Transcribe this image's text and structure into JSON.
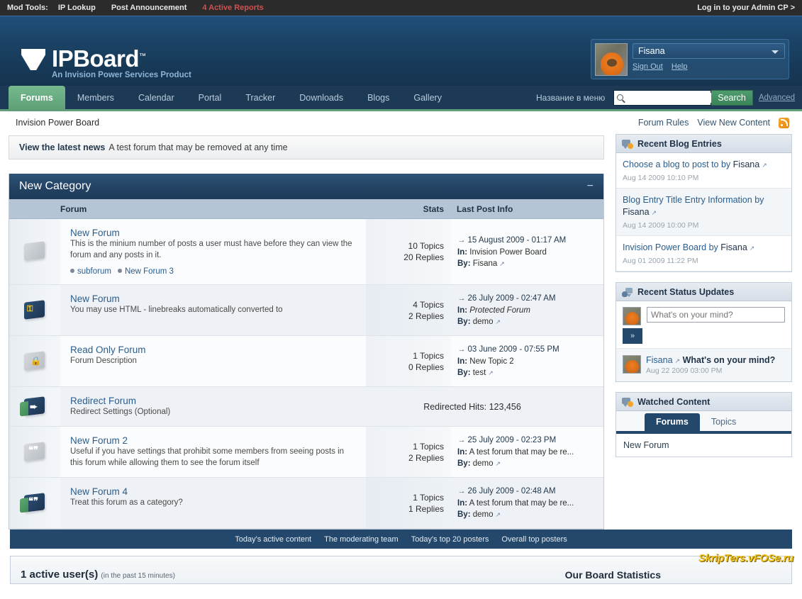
{
  "modbar": {
    "label": "Mod Tools:",
    "links": [
      "IP Lookup",
      "Post Announcement"
    ],
    "reports": "4 Active Reports",
    "admin_cp": "Log in to your Admin CP >"
  },
  "header": {
    "logo_text": "IPBoard",
    "logo_tm": "™",
    "tagline": "An Invision Power Services Product",
    "user": {
      "name": "Fisana",
      "sign_out": "Sign Out",
      "help": "Help"
    }
  },
  "nav": {
    "tabs": [
      {
        "label": "Forums",
        "active": true
      },
      {
        "label": "Members",
        "active": false
      },
      {
        "label": "Calendar",
        "active": false
      },
      {
        "label": "Portal",
        "active": false
      },
      {
        "label": "Tracker",
        "active": false
      },
      {
        "label": "Downloads",
        "active": false
      },
      {
        "label": "Blogs",
        "active": false
      },
      {
        "label": "Gallery",
        "active": false
      }
    ],
    "menu_title": "Название в меню",
    "search_value": "",
    "search_placeholder": "",
    "search_button": "Search",
    "advanced": "Advanced"
  },
  "breadcrumb": "Invision Power Board",
  "toplinks": {
    "forum_rules": "Forum Rules",
    "view_new_content": "View New Content"
  },
  "news": {
    "title": "View the latest news",
    "text": "A test forum that may be removed at any time"
  },
  "category": {
    "title": "New Category",
    "collapse": "−",
    "columns": {
      "forum": "Forum",
      "stats": "Stats",
      "last_post": "Last Post Info"
    },
    "forums": [
      {
        "icon": "folder-gray-icon",
        "title": "New Forum",
        "desc": "This is the minium number of posts a user must have before they can view the forum and any posts in it.",
        "subforums": [
          "subforum",
          "New Forum 3"
        ],
        "topics": "10 Topics",
        "replies": "20 Replies",
        "last_date": "15 August 2009 - 01:17 AM",
        "last_in_label": "In:",
        "last_in": "Invision Power Board",
        "last_in_italic": false,
        "last_by_label": "By:",
        "last_by": "Fisana"
      },
      {
        "icon": "forum-key-icon",
        "title": "New Forum",
        "desc": "You may use HTML - linebreaks automatically converted to",
        "subforums": [],
        "topics": "4 Topics",
        "replies": "2 Replies",
        "last_date": "26 July 2009 - 02:47 AM",
        "last_in_label": "In:",
        "last_in": "Protected Forum",
        "last_in_italic": true,
        "last_by_label": "By:",
        "last_by": "demo"
      },
      {
        "icon": "forum-lock-icon",
        "title": "Read Only Forum",
        "desc": "Forum Description",
        "subforums": [],
        "topics": "1 Topics",
        "replies": "0 Replies",
        "last_date": "03 June 2009 - 07:55 PM",
        "last_in_label": "In:",
        "last_in": "New Topic 2",
        "last_in_italic": false,
        "last_by_label": "By:",
        "last_by": "test"
      },
      {
        "icon": "forum-redirect-icon",
        "title": "Redirect Forum",
        "desc": "Redirect Settings (Optional)",
        "subforums": [],
        "redirect_text": "Redirected Hits: 123,456"
      },
      {
        "icon": "forum-quote-gray-icon",
        "title": "New Forum 2",
        "desc": "Useful if you have settings that prohibit some members from seeing posts in this forum while allowing them to see the forum itself",
        "subforums": [],
        "topics": "1 Topics",
        "replies": "2 Replies",
        "last_date": "25 July 2009 - 02:23 PM",
        "last_in_label": "In:",
        "last_in": "A test forum that may be re...",
        "last_in_italic": false,
        "last_by_label": "By:",
        "last_by": "demo"
      },
      {
        "icon": "forum-quote-navy-icon",
        "title": "New Forum 4",
        "desc": "Treat this forum as a category?",
        "subforums": [],
        "topics": "1 Topics",
        "replies": "1 Replies",
        "last_date": "26 July 2009 - 02:48 AM",
        "last_in_label": "In:",
        "last_in": "A test forum that may be re...",
        "last_in_italic": false,
        "last_by_label": "By:",
        "last_by": "demo"
      }
    ]
  },
  "sidebar": {
    "blog": {
      "title": "Recent Blog Entries",
      "entries": [
        {
          "title": "Choose a blog to post to by ",
          "author": "Fisana",
          "date": "Aug 14 2009 10:10 PM"
        },
        {
          "title": "Blog Entry Title Entry Information by ",
          "author": "Fisana",
          "date": "Aug 14 2009 10:00 PM"
        },
        {
          "title": "Invision Power Board by ",
          "author": "Fisana",
          "date": "Aug 01 2009 11:22 PM"
        }
      ]
    },
    "status": {
      "title": "Recent Status Updates",
      "input_placeholder": "What's on your mind?",
      "submit": "»",
      "items": [
        {
          "author": "Fisana",
          "text": "What's on your mind?",
          "date": "Aug 22 2009 03:00 PM"
        }
      ]
    },
    "watched": {
      "title": "Watched Content",
      "tabs": [
        {
          "label": "Forums",
          "active": true
        },
        {
          "label": "Topics",
          "active": false
        }
      ],
      "items": [
        "New Forum"
      ]
    }
  },
  "bottom": {
    "links": [
      "Today's active content",
      "The moderating team",
      "Today's top 20 posters",
      "Overall top posters"
    ],
    "active_users": "1 active user(s)",
    "active_users_note": "(in the past 15 minutes)",
    "board_stats": "Our Board Statistics",
    "watermark": "SkripTers.vFOSe.ru"
  }
}
